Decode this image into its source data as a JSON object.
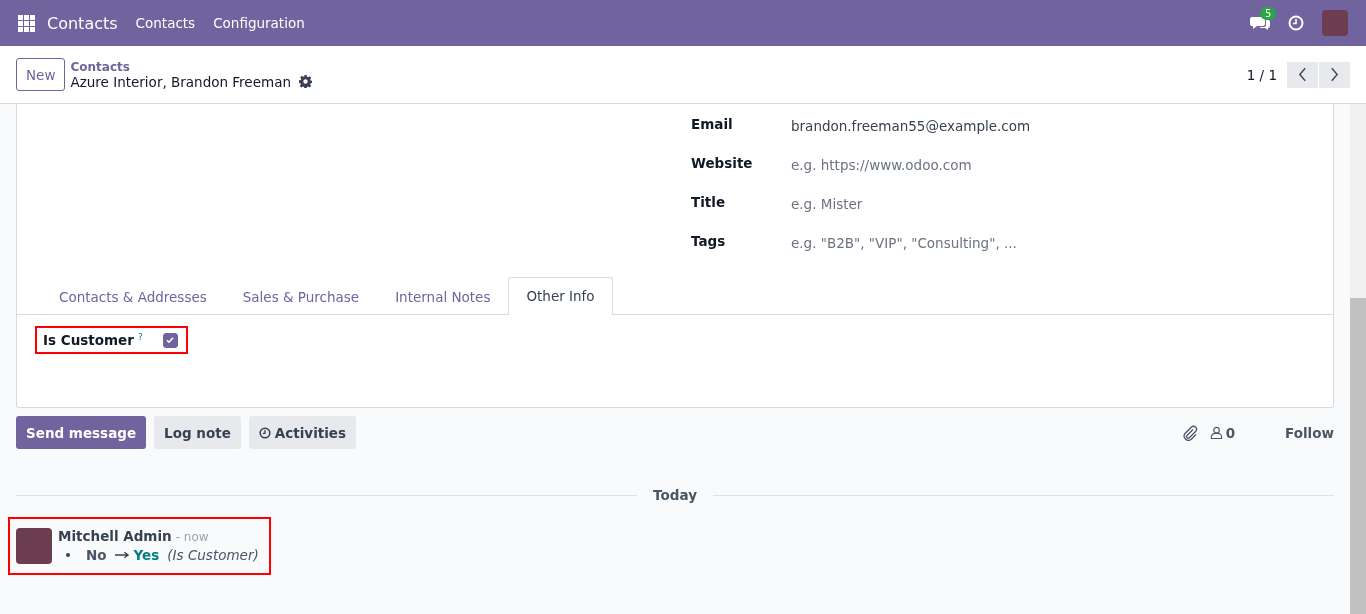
{
  "navbar": {
    "app_name": "Contacts",
    "menus": [
      "Contacts",
      "Configuration"
    ],
    "message_count": "5"
  },
  "control_panel": {
    "new_button": "New",
    "breadcrumb": "Contacts",
    "record_title": "Azure Interior, Brandon Freeman",
    "pager": "1 / 1"
  },
  "fields": [
    {
      "label": "Email",
      "value": "brandon.freeman55@example.com"
    },
    {
      "label": "Website",
      "placeholder": "e.g. https://www.odoo.com"
    },
    {
      "label": "Title",
      "placeholder": "e.g. Mister"
    },
    {
      "label": "Tags",
      "placeholder": "e.g. \"B2B\", \"VIP\", \"Consulting\", ..."
    }
  ],
  "tabs": [
    {
      "label": "Contacts & Addresses",
      "selected": false
    },
    {
      "label": "Sales & Purchase",
      "selected": false
    },
    {
      "label": "Internal Notes",
      "selected": false
    },
    {
      "label": "Other Info",
      "selected": true
    }
  ],
  "other_info": {
    "label": "Is Customer",
    "help_mark": "?",
    "checked": true,
    "highlighted": true
  },
  "chatter": {
    "buttons": [
      {
        "label": "Send message",
        "kind": "primary"
      },
      {
        "label": "Log note",
        "kind": "secondary"
      },
      {
        "label": "Activities",
        "kind": "activities"
      }
    ],
    "follower_count": "0",
    "follow": "Follow",
    "divider": "Today",
    "messages": [
      {
        "author": "Mitchell Admin",
        "time": "- now",
        "old_value": "No",
        "new_value": "Yes",
        "field": "(Is Customer)",
        "highlighted": true
      }
    ]
  }
}
